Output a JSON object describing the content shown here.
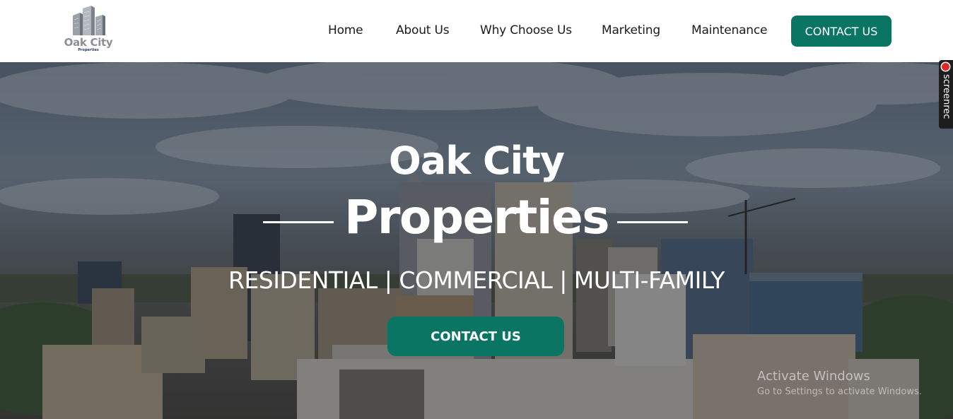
{
  "header": {
    "logo": {
      "name": "Oak City",
      "subtitle": "Properties",
      "icon": "buildings-logo-icon"
    },
    "nav": [
      {
        "label": "Home"
      },
      {
        "label": "About Us"
      },
      {
        "label": "Why Choose Us"
      },
      {
        "label": "Marketing"
      },
      {
        "label": "Maintenance"
      }
    ],
    "cta_label": "CONTACT US"
  },
  "hero": {
    "title_line1": "Oak City",
    "title_line2": "Properties",
    "subtitle": "RESIDENTIAL | COMMERCIAL | MULTI-FAMILY",
    "cta_label": "CONTACT US"
  },
  "overlay_widgets": {
    "screenrec_label": "screenrec",
    "activate_windows_title": "Activate Windows",
    "activate_windows_sub": "Go to Settings to activate Windows."
  },
  "colors": {
    "accent": "#0b7564",
    "nav_text": "#1b1b1b",
    "hero_text": "#ffffff"
  }
}
